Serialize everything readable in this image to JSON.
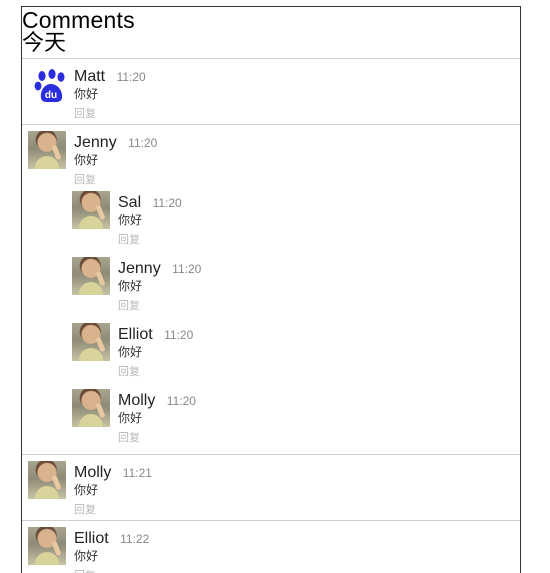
{
  "header": {
    "title": "Comments",
    "date": "今天"
  },
  "actions": {
    "reply_label": "回复"
  },
  "comments": [
    {
      "name": "Matt",
      "time": "11:20",
      "message": "你好",
      "avatar": "baidu-paw-logo-icon"
    },
    {
      "name": "Jenny",
      "time": "11:20",
      "message": "你好",
      "avatar": "user-photo-avatar"
    },
    {
      "name": "Sal",
      "time": "11:20",
      "message": "你好",
      "avatar": "user-photo-avatar"
    },
    {
      "name": "Jenny",
      "time": "11:20",
      "message": "你好",
      "avatar": "user-photo-avatar"
    },
    {
      "name": "Elliot",
      "time": "11:20",
      "message": "你好",
      "avatar": "user-photo-avatar"
    },
    {
      "name": "Molly",
      "time": "11:20",
      "message": "你好",
      "avatar": "user-photo-avatar"
    },
    {
      "name": "Molly",
      "time": "11:21",
      "message": "你好",
      "avatar": "user-photo-avatar"
    },
    {
      "name": "Elliot",
      "time": "11:22",
      "message": "你好",
      "avatar": "user-photo-avatar"
    }
  ],
  "colors": {
    "border": "#333333",
    "separator": "#cfcfcf",
    "time_text": "#888888",
    "reply_text": "#b9b9b9",
    "baidu_blue": "#2d2de0"
  }
}
